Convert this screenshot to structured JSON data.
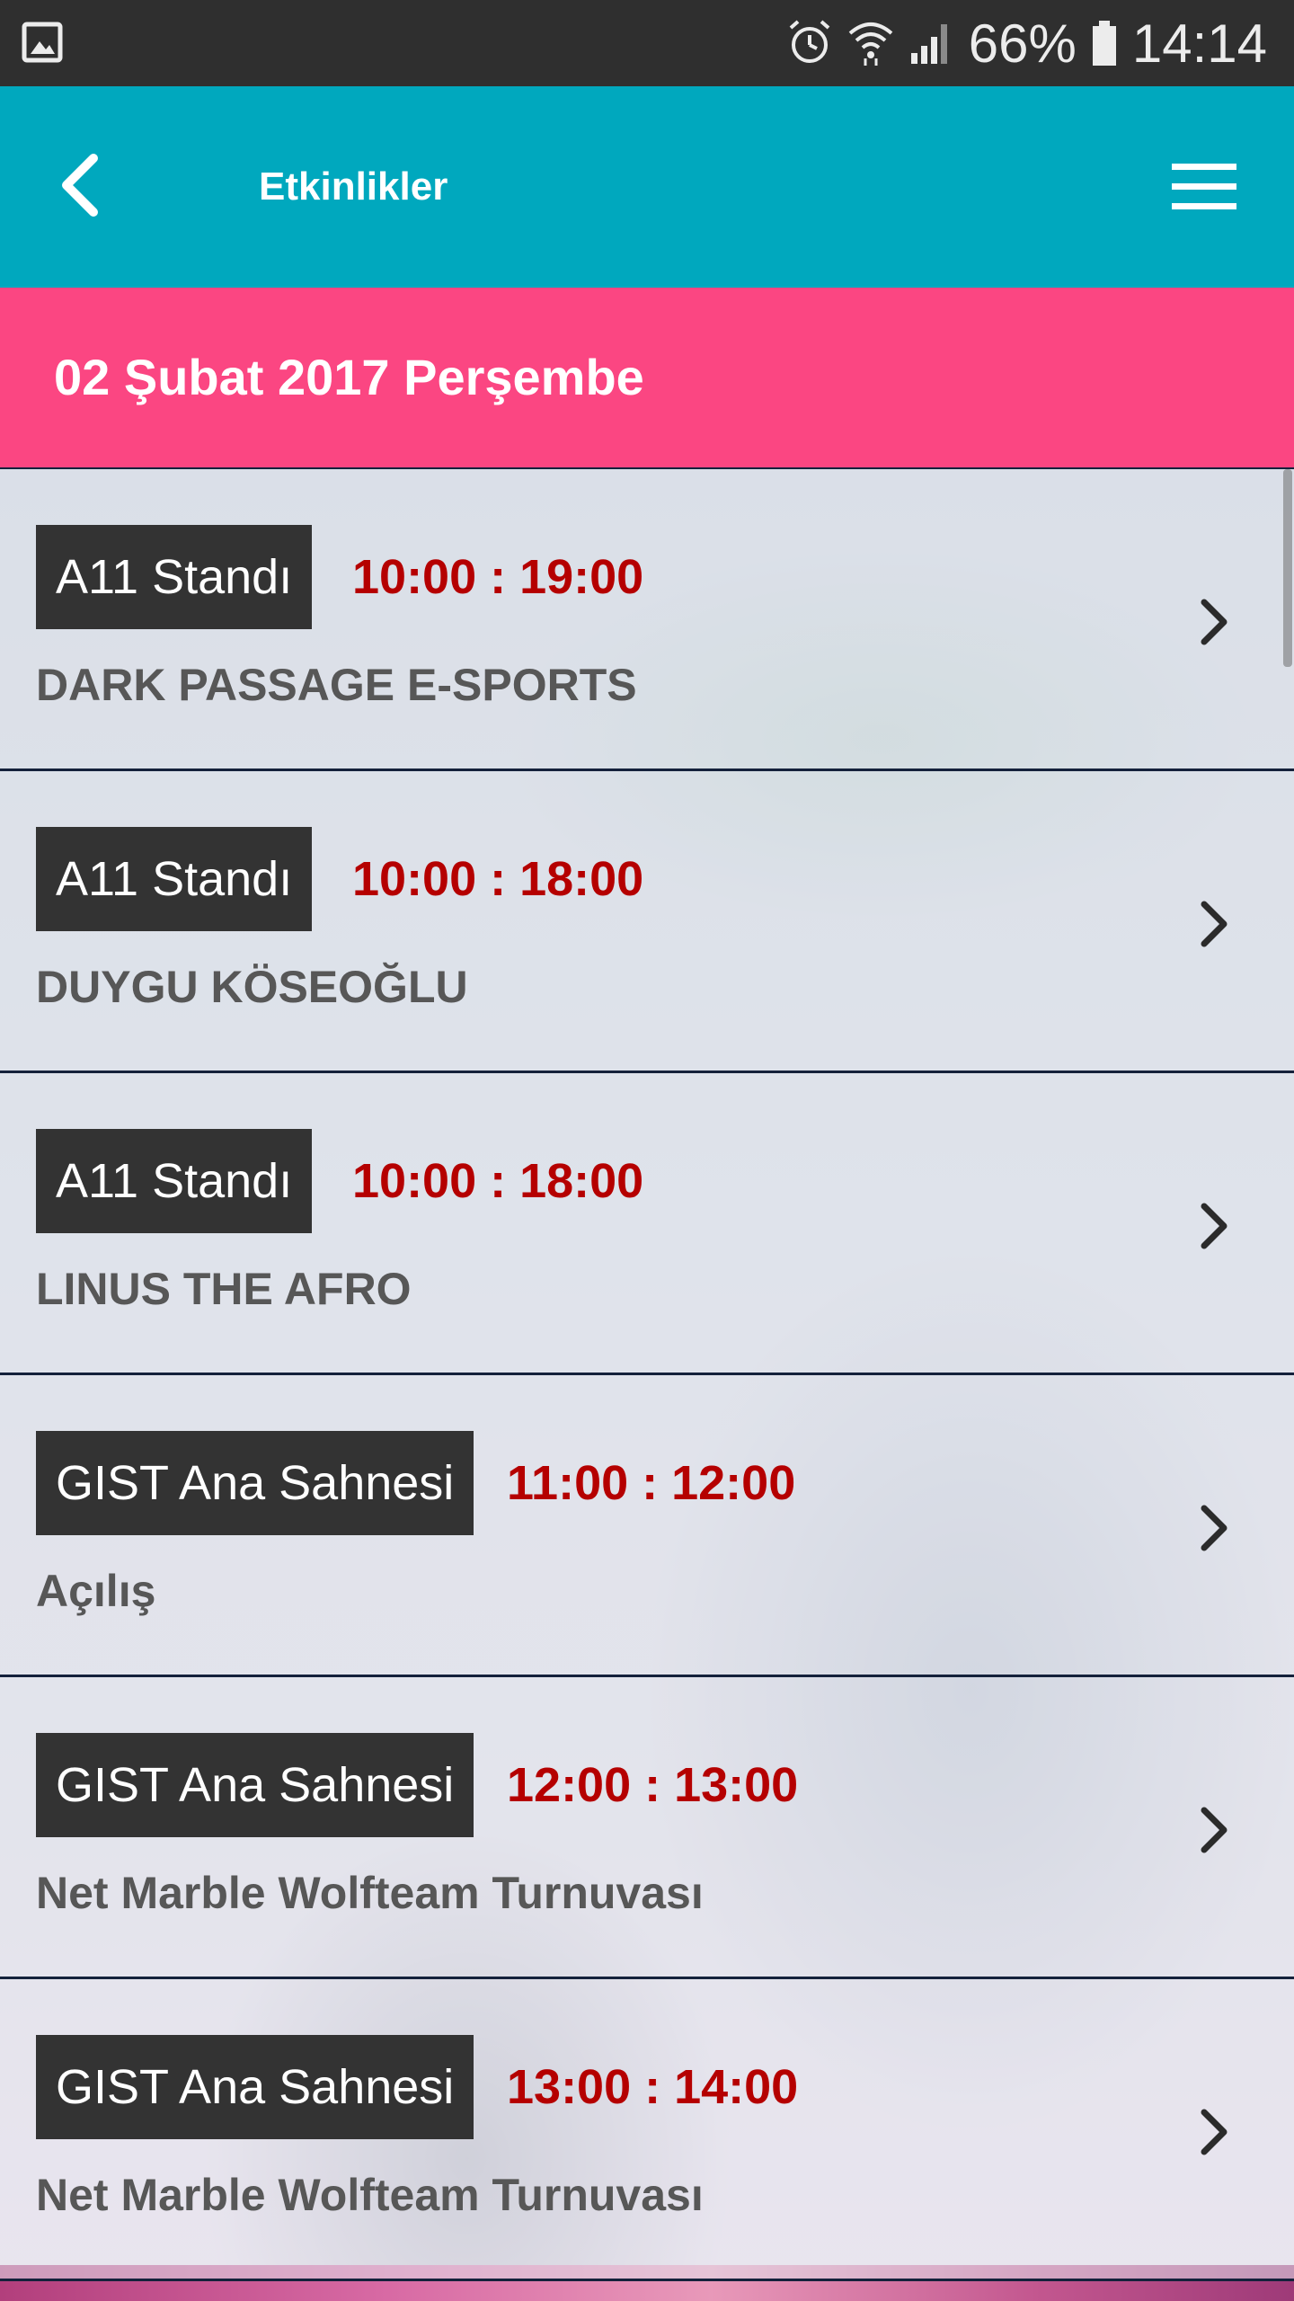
{
  "status_bar": {
    "battery_percent": "66%",
    "time": "14:14",
    "icons": [
      "image-icon",
      "alarm-icon",
      "wifi-icon",
      "signal-icon",
      "battery-icon"
    ]
  },
  "app_bar": {
    "title": "Etkinlikler",
    "back_icon": "chevron-left-icon",
    "menu_icon": "hamburger-menu-icon"
  },
  "date_header": {
    "label": "02 Şubat 2017 Perşembe"
  },
  "events": [
    {
      "venue": "A11 Standı",
      "time": "10:00 : 19:00",
      "title": "DARK PASSAGE E-SPORTS"
    },
    {
      "venue": "A11 Standı",
      "time": "10:00 : 18:00",
      "title": "DUYGU KÖSEOĞLU"
    },
    {
      "venue": "A11 Standı",
      "time": "10:00 : 18:00",
      "title": "LINUS THE AFRO"
    },
    {
      "venue": "GIST Ana Sahnesi",
      "time": "11:00 : 12:00",
      "title": "Açılış"
    },
    {
      "venue": "GIST Ana Sahnesi",
      "time": "12:00 : 13:00",
      "title": "Net Marble Wolfteam Turnuvası"
    },
    {
      "venue": "GIST Ana Sahnesi",
      "time": "13:00 : 14:00",
      "title": "Net Marble Wolfteam Turnuvası"
    }
  ],
  "colors": {
    "status_bar": "#2f2f2f",
    "app_bar": "#00a8be",
    "date_header": "#fb4682",
    "venue_badge": "#333333",
    "time_text": "#b50000",
    "event_title": "#575757",
    "divider": "#14213b"
  }
}
